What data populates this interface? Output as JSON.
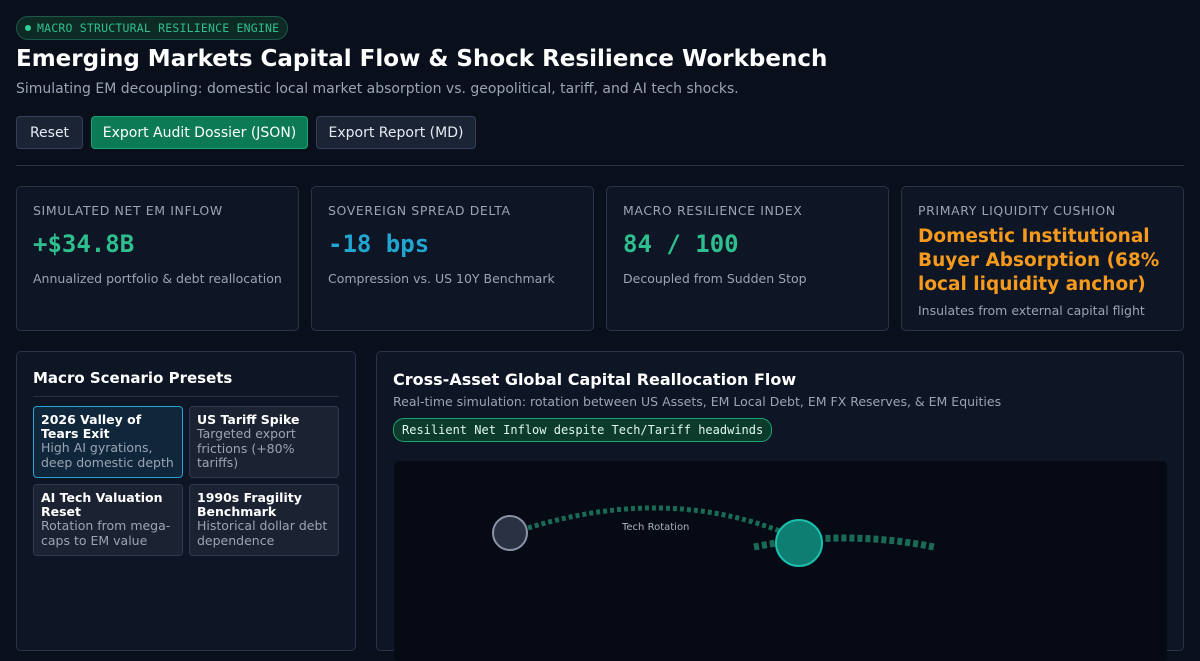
{
  "header": {
    "badge": "MACRO STRUCTURAL RESILIENCE ENGINE",
    "title": "Emerging Markets Capital Flow & Shock Resilience Workbench",
    "subtitle": "Simulating EM decoupling: domestic local market absorption vs. geopolitical, tariff, and AI tech shocks."
  },
  "toolbar": {
    "reset_label": "Reset",
    "export_json_label": "Export Audit Dossier (JSON)",
    "export_md_label": "Export Report (MD)"
  },
  "kpis": [
    {
      "label": "SIMULATED NET EM INFLOW",
      "value": "+$34.8B",
      "note": "Annualized portfolio & debt reallocation"
    },
    {
      "label": "SOVEREIGN SPREAD DELTA",
      "value": "-18 bps",
      "note": "Compression vs. US 10Y Benchmark"
    },
    {
      "label": "MACRO RESILIENCE INDEX",
      "value": "84 / 100",
      "note": "Decoupled from Sudden Stop"
    },
    {
      "label": "PRIMARY LIQUIDITY CUSHION",
      "value": "Domestic Institutional Buyer Absorption (68% local liquidity anchor)",
      "note": "Insulates from external capital flight"
    }
  ],
  "presets": {
    "title": "Macro Scenario Presets",
    "items": [
      {
        "name": "2026 Valley of Tears Exit",
        "desc": "High AI gyrations, deep domestic depth"
      },
      {
        "name": "US Tariff Spike",
        "desc": "Targeted export frictions (+80% tariffs)"
      },
      {
        "name": "AI Tech Valuation Reset",
        "desc": "Rotation from mega-caps to EM value"
      },
      {
        "name": "1990s Fragility Benchmark",
        "desc": "Historical dollar debt dependence"
      }
    ]
  },
  "flow": {
    "title": "Cross-Asset Global Capital Reallocation Flow",
    "subtitle": "Real-time simulation: rotation between US Assets, EM Local Debt, EM FX Reserves, & EM Equities",
    "status_pill": "Resilient Net Inflow despite Tech/Tariff headwinds",
    "edge_label": "Tech Rotation"
  },
  "colors": {
    "accent_green": "#2fbf8e",
    "accent_cyan": "#22a6d1",
    "accent_orange": "#f59a1c",
    "primary_button": "#0b7a55"
  }
}
